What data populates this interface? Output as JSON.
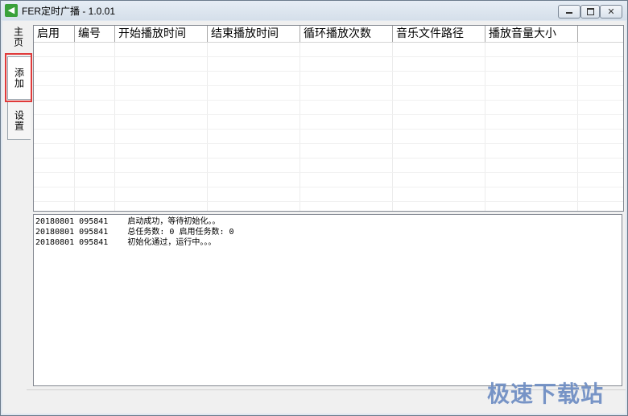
{
  "window": {
    "title": "FER定时广播 - 1.0.01",
    "icon": "speaker-icon"
  },
  "tabs": [
    {
      "label": "主页"
    },
    {
      "label": "添加"
    },
    {
      "label": "设置"
    }
  ],
  "table": {
    "columns": [
      "启用",
      "编号",
      "开始播放时间",
      "结束播放时间",
      "循环播放次数",
      "音乐文件路径",
      "播放音量大小"
    ]
  },
  "log": {
    "lines": [
      "20180801 095841    启动成功，等待初始化。。",
      "20180801 095841    总任务数: 0 启用任务数: 0",
      "20180801 095841    初始化通过，运行中。。。"
    ]
  },
  "watermark": "极速下载站"
}
